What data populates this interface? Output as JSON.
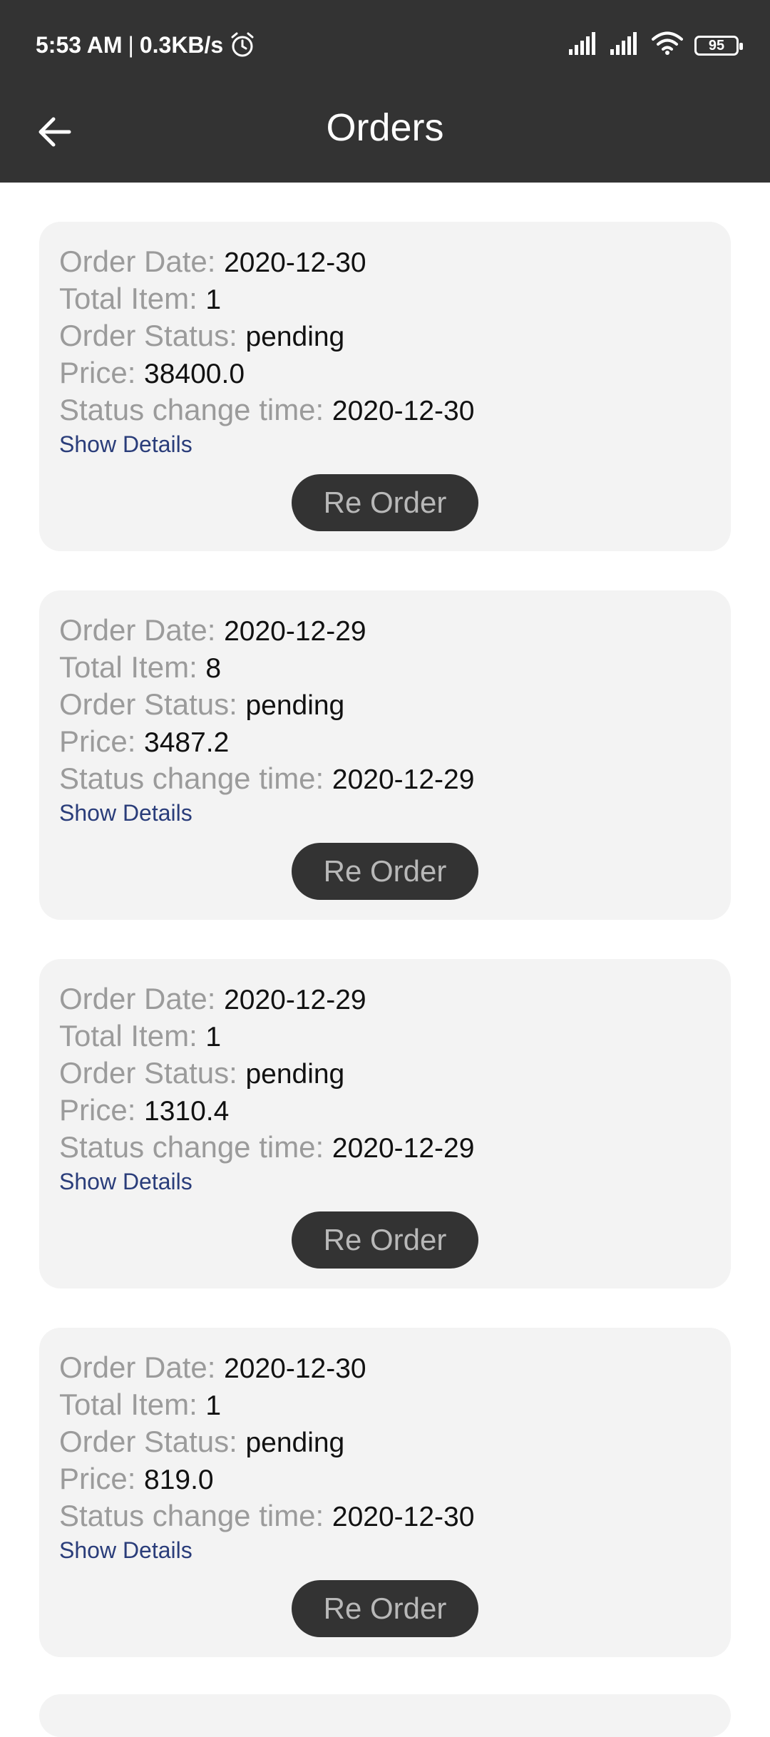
{
  "status_bar": {
    "time": "5:53 AM",
    "separator": "|",
    "network_speed": "0.3KB/s",
    "battery": "95"
  },
  "app_bar": {
    "title": "Orders",
    "back_icon": "arrow-left-icon"
  },
  "labels": {
    "order_date": "Order Date:",
    "total_item": "Total Item:",
    "order_status": "Order Status:",
    "price": "Price:",
    "status_change_time": "Status change time:",
    "show_details": "Show Details",
    "reorder": "Re Order"
  },
  "orders": [
    {
      "order_date": "2020-12-30",
      "total_item": "1",
      "order_status": "pending",
      "price": "38400.0",
      "status_change_time": "2020-12-30"
    },
    {
      "order_date": "2020-12-29",
      "total_item": "8",
      "order_status": "pending",
      "price": "3487.2",
      "status_change_time": "2020-12-29"
    },
    {
      "order_date": "2020-12-29",
      "total_item": "1",
      "order_status": "pending",
      "price": "1310.4",
      "status_change_time": "2020-12-29"
    },
    {
      "order_date": "2020-12-30",
      "total_item": "1",
      "order_status": "pending",
      "price": "819.0",
      "status_change_time": "2020-12-30"
    }
  ],
  "colors": {
    "header_bg": "#333333",
    "card_bg": "#f3f3f3",
    "label_gray": "#9b9b9b",
    "link_blue": "#2a3d7a",
    "button_bg": "#333333",
    "button_text": "#b8b8b8"
  }
}
